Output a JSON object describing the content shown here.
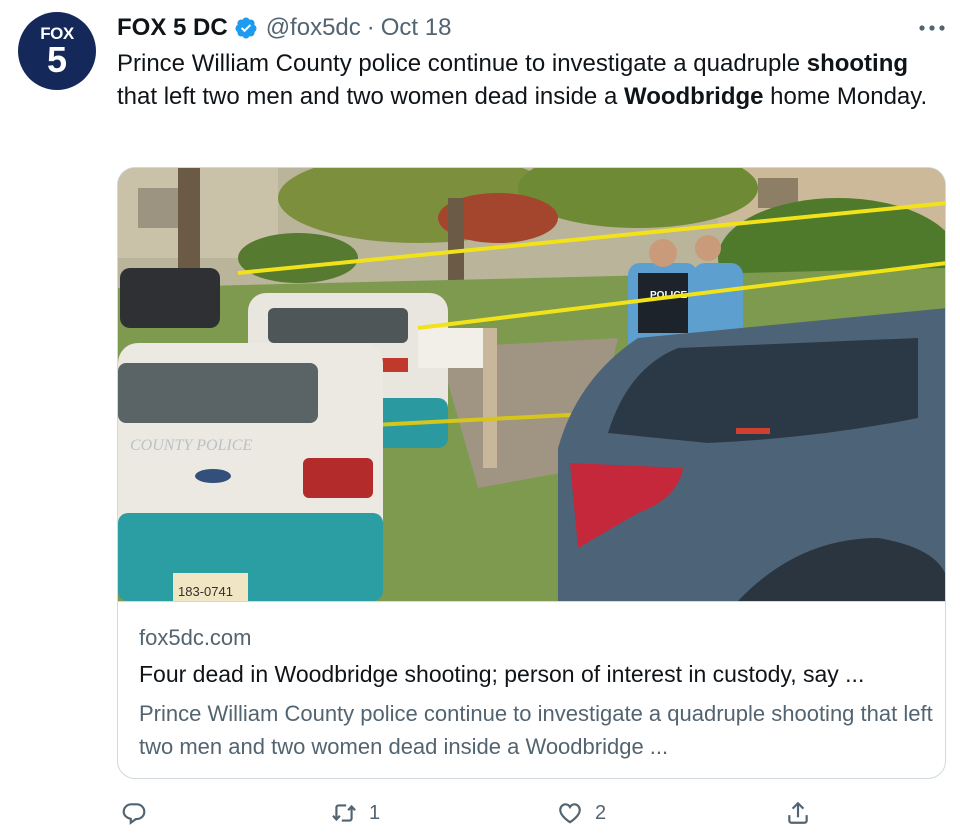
{
  "account": {
    "avatar_line1": "FOX",
    "avatar_line2": "5",
    "name": "FOX 5 DC",
    "handle": "@fox5dc",
    "separator": "·",
    "date": "Oct 18",
    "avatar_color": "#14285a",
    "verified_color": "#1d9bf0"
  },
  "tweet": {
    "parts": [
      {
        "text": "Prince William County police continue to investigate a quadruple ",
        "bold": false
      },
      {
        "text": "shooting",
        "bold": true
      },
      {
        "text": " that left two men and two women dead inside a ",
        "bold": false
      },
      {
        "text": "Woodbridge",
        "bold": true
      },
      {
        "text": " home Monday.",
        "bold": false
      }
    ]
  },
  "card": {
    "domain": "fox5dc.com",
    "title": "Four dead in Woodbridge shooting; person of interest in custody, say ...",
    "description": "Prince William County police continue to investigate a quadruple shooting that left two men and two women dead inside a Woodbridge ...",
    "image_text": {
      "car_label": "COUNTY POLICE",
      "plate": "183-0741",
      "vest": "POLICE"
    }
  },
  "actions": {
    "reply_icon": "reply-icon",
    "retweet_icon": "retweet-icon",
    "retweet_count": "1",
    "like_icon": "heart-icon",
    "like_count": "2",
    "share_icon": "share-icon",
    "more_icon": "more-icon"
  },
  "colors": {
    "text": "#0f1419",
    "secondary": "#536471",
    "border": "#cfd9de"
  }
}
